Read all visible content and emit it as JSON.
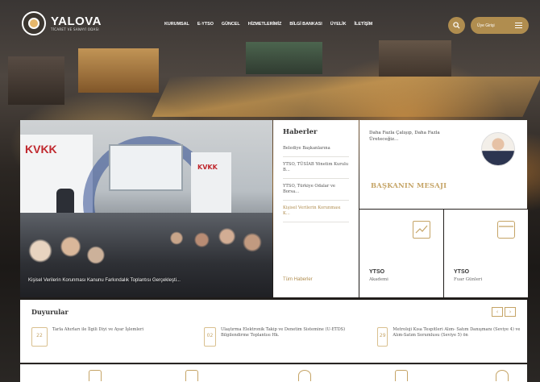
{
  "logo": {
    "name": "YALOVA",
    "subtitle": "TİCARET VE SANAYİ ODASI"
  },
  "nav": [
    "KURUMSAL",
    "E-YTSO",
    "GÜNCEL",
    "HİZMETLERİMİZ",
    "BİLGİ BANKASI",
    "ÜYELİK",
    "İLETİŞİM"
  ],
  "login_label": "Üye Girişi",
  "slider": {
    "caption": "Kişisel Verilerin Korunması Kanunu Farkındalık Toplantısı Gerçekleşti..."
  },
  "news": {
    "title": "Haberler",
    "items": [
      "Belediye Başkanlarına",
      "YTSO, TÜSİAB Yönetim Kurulu B...",
      "YTSO, Türkiye Odalar ve Borsa...",
      "Kişisel Verilerin Korunması K..."
    ],
    "all": "Tüm Haberler"
  },
  "president": {
    "quote": "Daha Fazla Çalışıp, Daha Fazla Üreteceğiz...",
    "label": "BAŞKANIN MESAJI"
  },
  "tiles": [
    {
      "title": "YTSO",
      "sub": "Akademi"
    },
    {
      "title": "YTSO",
      "sub": "Fuar Günleri"
    }
  ],
  "announcements": {
    "title": "Duyurular",
    "items": [
      {
        "day": "22",
        "text": "Tarla Ahırları ile İlgili Diyi ve Ayar İşlemleri"
      },
      {
        "day": "02",
        "text": "Ulaştırma Elektronik Takip ve Denetim Sistemine (U-ETDS) Bilgilendirme Toplantısı Hk."
      },
      {
        "day": "29",
        "text": "Metroloji Kısa Tespitleri Alım- Satım Danışmanı (Seviye 4) ve Alım-Satım Sorumlusu (Seviye 5) ön"
      }
    ]
  },
  "colors": {
    "accent": "#b08d4f",
    "gold": "#c5a466"
  },
  "icons": [
    "search-icon",
    "menu-icon",
    "chart-icon",
    "calendar-icon"
  ]
}
